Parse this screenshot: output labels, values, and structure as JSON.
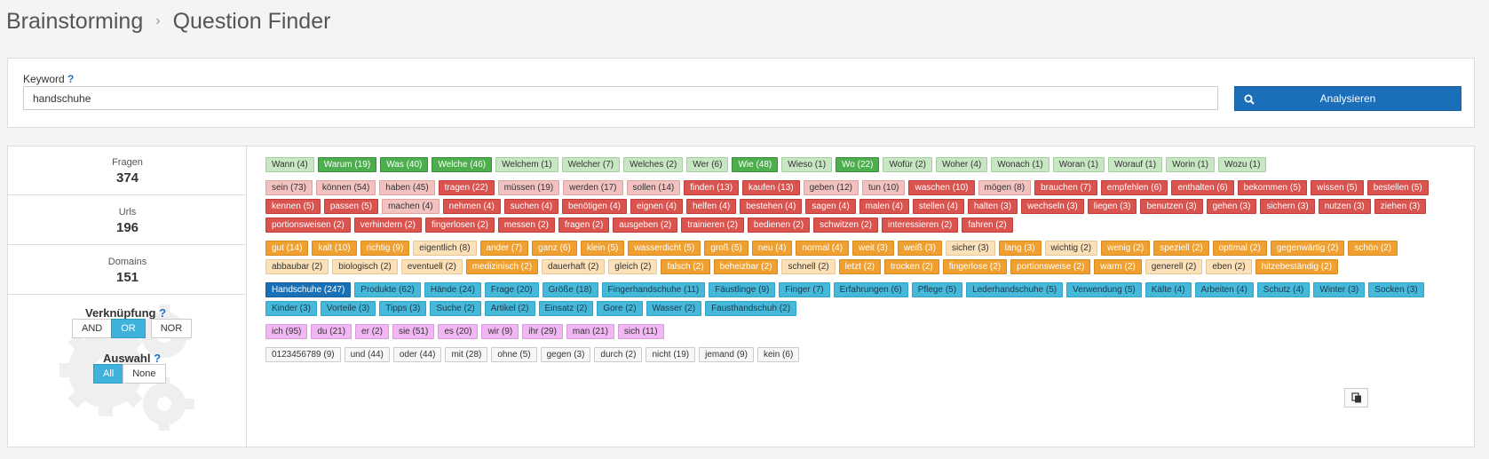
{
  "breadcrumb": {
    "root": "Brainstorming",
    "current": "Question Finder"
  },
  "search": {
    "label": "Keyword",
    "help": "?",
    "value": "handschuhe",
    "button_label": "Analysieren"
  },
  "stats": [
    {
      "label": "Fragen",
      "value": "374"
    },
    {
      "label": "Urls",
      "value": "196"
    },
    {
      "label": "Domains",
      "value": "151"
    }
  ],
  "controls": {
    "verknuepfung": {
      "label": "Verknüpfung",
      "help": "?",
      "options": [
        "AND",
        "OR",
        "NOR"
      ],
      "selected": "OR"
    },
    "auswahl": {
      "label": "Auswahl",
      "help": "?",
      "options": [
        "All",
        "None"
      ],
      "selected": "All"
    }
  },
  "colors": {
    "accent": "#1a6fb8",
    "active_toggle": "#3fb2dc"
  },
  "tag_groups": [
    {
      "name": "questions",
      "tags": [
        {
          "t": "Wann (4)",
          "c": "green-l"
        },
        {
          "t": "Warum (19)",
          "c": "green-d"
        },
        {
          "t": "Was (40)",
          "c": "green-d"
        },
        {
          "t": "Welche (46)",
          "c": "green-d"
        },
        {
          "t": "Welchem (1)",
          "c": "green-l"
        },
        {
          "t": "Welcher (7)",
          "c": "green-l"
        },
        {
          "t": "Welches (2)",
          "c": "green-l"
        },
        {
          "t": "Wer (6)",
          "c": "green-l"
        },
        {
          "t": "Wie (48)",
          "c": "green-d"
        },
        {
          "t": "Wieso (1)",
          "c": "green-l"
        },
        {
          "t": "Wo (22)",
          "c": "green-d"
        },
        {
          "t": "Wofür (2)",
          "c": "green-l"
        },
        {
          "t": "Woher (4)",
          "c": "green-l"
        },
        {
          "t": "Wonach (1)",
          "c": "green-l"
        },
        {
          "t": "Woran (1)",
          "c": "green-l"
        },
        {
          "t": "Worauf (1)",
          "c": "green-l"
        },
        {
          "t": "Worin (1)",
          "c": "green-l"
        },
        {
          "t": "Wozu (1)",
          "c": "green-l"
        }
      ]
    },
    {
      "name": "verbs",
      "tags": [
        {
          "t": "sein (73)",
          "c": "red-l"
        },
        {
          "t": "können (54)",
          "c": "red-l"
        },
        {
          "t": "haben (45)",
          "c": "red-l"
        },
        {
          "t": "tragen (22)",
          "c": "red-d"
        },
        {
          "t": "müssen (19)",
          "c": "red-l"
        },
        {
          "t": "werden (17)",
          "c": "red-l"
        },
        {
          "t": "sollen (14)",
          "c": "red-l"
        },
        {
          "t": "finden (13)",
          "c": "red-d"
        },
        {
          "t": "kaufen (13)",
          "c": "red-d"
        },
        {
          "t": "geben (12)",
          "c": "red-l"
        },
        {
          "t": "tun (10)",
          "c": "red-l"
        },
        {
          "t": "waschen (10)",
          "c": "red-d"
        },
        {
          "t": "mögen (8)",
          "c": "red-l"
        },
        {
          "t": "brauchen (7)",
          "c": "red-d"
        },
        {
          "t": "empfehlen (6)",
          "c": "red-d"
        },
        {
          "t": "enthalten (6)",
          "c": "red-d"
        },
        {
          "t": "bekommen (5)",
          "c": "red-d"
        },
        {
          "t": "wissen (5)",
          "c": "red-d"
        },
        {
          "t": "bestellen (5)",
          "c": "red-d"
        },
        {
          "t": "kennen (5)",
          "c": "red-d"
        },
        {
          "t": "passen (5)",
          "c": "red-d"
        },
        {
          "t": "machen (4)",
          "c": "red-l"
        },
        {
          "t": "nehmen (4)",
          "c": "red-d"
        },
        {
          "t": "suchen (4)",
          "c": "red-d"
        },
        {
          "t": "benötigen (4)",
          "c": "red-d"
        },
        {
          "t": "eignen (4)",
          "c": "red-d"
        },
        {
          "t": "helfen (4)",
          "c": "red-d"
        },
        {
          "t": "bestehen (4)",
          "c": "red-d"
        },
        {
          "t": "sagen (4)",
          "c": "red-d"
        },
        {
          "t": "malen (4)",
          "c": "red-d"
        },
        {
          "t": "stellen (4)",
          "c": "red-d"
        },
        {
          "t": "halten (3)",
          "c": "red-d"
        },
        {
          "t": "wechseln (3)",
          "c": "red-d"
        },
        {
          "t": "liegen (3)",
          "c": "red-d"
        },
        {
          "t": "benutzen (3)",
          "c": "red-d"
        },
        {
          "t": "gehen (3)",
          "c": "red-d"
        },
        {
          "t": "sichern (3)",
          "c": "red-d"
        },
        {
          "t": "nutzen (3)",
          "c": "red-d"
        },
        {
          "t": "ziehen (3)",
          "c": "red-d"
        },
        {
          "t": "portionsweisen (2)",
          "c": "red-d"
        },
        {
          "t": "verhindern (2)",
          "c": "red-d"
        },
        {
          "t": "fingerlosen (2)",
          "c": "red-d"
        },
        {
          "t": "messen (2)",
          "c": "red-d"
        },
        {
          "t": "fragen (2)",
          "c": "red-d"
        },
        {
          "t": "ausgeben (2)",
          "c": "red-d"
        },
        {
          "t": "trainieren (2)",
          "c": "red-d"
        },
        {
          "t": "bedienen (2)",
          "c": "red-d"
        },
        {
          "t": "schwitzen (2)",
          "c": "red-d"
        },
        {
          "t": "interessieren (2)",
          "c": "red-d"
        },
        {
          "t": "fahren (2)",
          "c": "red-d"
        }
      ]
    },
    {
      "name": "adjectives",
      "tags": [
        {
          "t": "gut (14)",
          "c": "org-d"
        },
        {
          "t": "kalt (10)",
          "c": "org-d"
        },
        {
          "t": "richtig (9)",
          "c": "org-d"
        },
        {
          "t": "eigentlich (8)",
          "c": "org-l"
        },
        {
          "t": "ander (7)",
          "c": "org-d"
        },
        {
          "t": "ganz (6)",
          "c": "org-d"
        },
        {
          "t": "klein (5)",
          "c": "org-d"
        },
        {
          "t": "wasserdicht (5)",
          "c": "org-d"
        },
        {
          "t": "groß (5)",
          "c": "org-d"
        },
        {
          "t": "neu (4)",
          "c": "org-d"
        },
        {
          "t": "normal (4)",
          "c": "org-d"
        },
        {
          "t": "weit (3)",
          "c": "org-d"
        },
        {
          "t": "weiß (3)",
          "c": "org-d"
        },
        {
          "t": "sicher (3)",
          "c": "org-l"
        },
        {
          "t": "lang (3)",
          "c": "org-d"
        },
        {
          "t": "wichtig (2)",
          "c": "org-l"
        },
        {
          "t": "wenig (2)",
          "c": "org-d"
        },
        {
          "t": "speziell (2)",
          "c": "org-d"
        },
        {
          "t": "optimal (2)",
          "c": "org-d"
        },
        {
          "t": "gegenwärtig (2)",
          "c": "org-d"
        },
        {
          "t": "schön (2)",
          "c": "org-d"
        },
        {
          "t": "abbaubar (2)",
          "c": "org-l"
        },
        {
          "t": "biologisch (2)",
          "c": "org-l"
        },
        {
          "t": "eventuell (2)",
          "c": "org-l"
        },
        {
          "t": "medizinisch (2)",
          "c": "org-d"
        },
        {
          "t": "dauerhaft (2)",
          "c": "org-l"
        },
        {
          "t": "gleich (2)",
          "c": "org-l"
        },
        {
          "t": "falsch (2)",
          "c": "org-d"
        },
        {
          "t": "beheizbar (2)",
          "c": "org-d"
        },
        {
          "t": "schnell (2)",
          "c": "org-l"
        },
        {
          "t": "letzt (2)",
          "c": "org-d"
        },
        {
          "t": "trocken (2)",
          "c": "org-d"
        },
        {
          "t": "fingerlose (2)",
          "c": "org-d"
        },
        {
          "t": "portionsweise (2)",
          "c": "org-d"
        },
        {
          "t": "warm (2)",
          "c": "org-d"
        },
        {
          "t": "generell (2)",
          "c": "org-l"
        },
        {
          "t": "eben (2)",
          "c": "org-l"
        },
        {
          "t": "hitzebeständig (2)",
          "c": "org-d"
        }
      ]
    },
    {
      "name": "nouns",
      "tags": [
        {
          "t": "Handschuhe (247)",
          "c": "blue-d"
        },
        {
          "t": "Produkte (62)",
          "c": "blue-m"
        },
        {
          "t": "Hände (24)",
          "c": "blue-m"
        },
        {
          "t": "Frage (20)",
          "c": "blue-m"
        },
        {
          "t": "Größe (18)",
          "c": "blue-m"
        },
        {
          "t": "Fingerhandschuhe (11)",
          "c": "blue-m"
        },
        {
          "t": "Fäustlinge (9)",
          "c": "blue-m"
        },
        {
          "t": "Finger (7)",
          "c": "blue-m"
        },
        {
          "t": "Erfahrungen (6)",
          "c": "blue-m"
        },
        {
          "t": "Pflege (5)",
          "c": "blue-m"
        },
        {
          "t": "Lederhandschuhe (5)",
          "c": "blue-m"
        },
        {
          "t": "Verwendung (5)",
          "c": "blue-m"
        },
        {
          "t": "Kälte (4)",
          "c": "blue-m"
        },
        {
          "t": "Arbeiten (4)",
          "c": "blue-m"
        },
        {
          "t": "Schutz (4)",
          "c": "blue-m"
        },
        {
          "t": "Winter (3)",
          "c": "blue-m"
        },
        {
          "t": "Socken (3)",
          "c": "blue-m"
        },
        {
          "t": "Kinder (3)",
          "c": "blue-m"
        },
        {
          "t": "Vorteile (3)",
          "c": "blue-m"
        },
        {
          "t": "Tipps (3)",
          "c": "blue-m"
        },
        {
          "t": "Suche (2)",
          "c": "blue-m"
        },
        {
          "t": "Artikel (2)",
          "c": "blue-m"
        },
        {
          "t": "Einsatz (2)",
          "c": "blue-m"
        },
        {
          "t": "Gore (2)",
          "c": "blue-m"
        },
        {
          "t": "Wasser (2)",
          "c": "blue-m"
        },
        {
          "t": "Fausthandschuh (2)",
          "c": "blue-m"
        }
      ]
    },
    {
      "name": "pronouns",
      "tags": [
        {
          "t": "ich (95)",
          "c": "pink"
        },
        {
          "t": "du (21)",
          "c": "pink"
        },
        {
          "t": "er (2)",
          "c": "pink"
        },
        {
          "t": "sie (51)",
          "c": "pink"
        },
        {
          "t": "es (20)",
          "c": "pink"
        },
        {
          "t": "wir (9)",
          "c": "pink"
        },
        {
          "t": "ihr (29)",
          "c": "pink"
        },
        {
          "t": "man (21)",
          "c": "pink"
        },
        {
          "t": "sich (11)",
          "c": "pink"
        }
      ]
    },
    {
      "name": "other",
      "tags": [
        {
          "t": "0123456789 (9)",
          "c": "grey"
        },
        {
          "t": "und (44)",
          "c": "grey"
        },
        {
          "t": "oder (44)",
          "c": "grey"
        },
        {
          "t": "mit (28)",
          "c": "grey"
        },
        {
          "t": "ohne (5)",
          "c": "grey"
        },
        {
          "t": "gegen (3)",
          "c": "grey"
        },
        {
          "t": "durch (2)",
          "c": "grey"
        },
        {
          "t": "nicht (19)",
          "c": "grey"
        },
        {
          "t": "jemand (9)",
          "c": "grey"
        },
        {
          "t": "kein (6)",
          "c": "grey"
        }
      ]
    }
  ]
}
